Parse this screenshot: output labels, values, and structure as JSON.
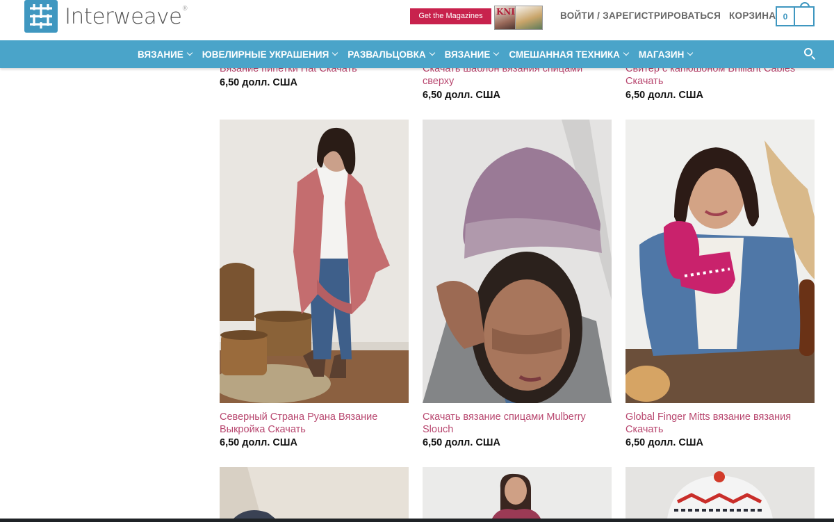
{
  "header": {
    "logo_text": "Interweave",
    "logo_reg": "®",
    "magazines_button": "Get the Magazines",
    "magazine_cover_text": "KNITS",
    "login_label": "ВОЙТИ / ЗАРЕГИСТРИРОВАТЬСЯ",
    "cart_label": "КОРЗИНА",
    "cart_count": "0"
  },
  "nav": {
    "items": [
      {
        "label": "ВЯЗАНИЕ"
      },
      {
        "label": "ЮВЕЛИРНЫЕ УКРАШЕНИЯ"
      },
      {
        "label": "РАЗВАЛЬЦОВКА"
      },
      {
        "label": "ВЯЗАНИЕ"
      },
      {
        "label": "СМЕШАННАЯ ТЕХНИКА"
      },
      {
        "label": "МАГАЗИН"
      }
    ]
  },
  "products_top": [
    {
      "title": "Вязание пипетки Hat Скачать",
      "price": "6,50 долл. США"
    },
    {
      "title": "Скачать шаблон вязания спицами сверху",
      "price": "6,50 долл. США"
    },
    {
      "title": "Свитер с капюшоном Brilliant Cables Скачать",
      "price": "6,50 долл. США"
    }
  ],
  "products_middle": [
    {
      "title": "Северный Страна Руана Вязание Выкройка Скачать",
      "price": "6,50 долл. США",
      "image": "woman-in-pink-ruana-photo"
    },
    {
      "title": "Скачать вязание спицами Mulberry Slouch",
      "price": "6,50 долл. США",
      "image": "woman-in-purple-hat-photo"
    },
    {
      "title": "Global Finger Mitts вязание вязания Скачать",
      "price": "6,50 долл. США",
      "image": "woman-in-pink-mittens-photo"
    }
  ],
  "colors": {
    "brand_blue": "#4aa4c9",
    "title_pink": "#b8476f",
    "magazine_red": "#c8224d"
  }
}
